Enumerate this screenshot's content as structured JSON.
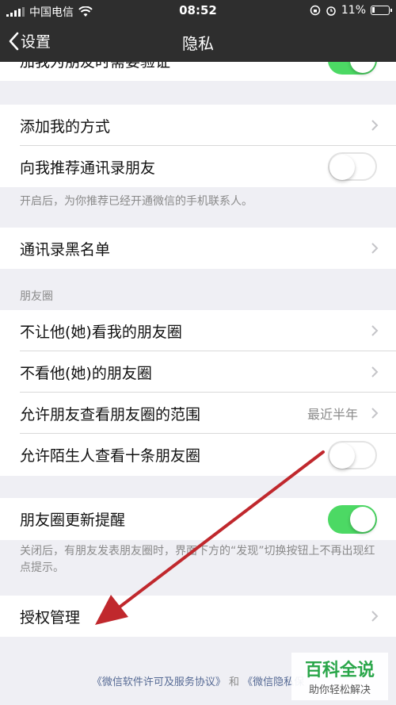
{
  "status_bar": {
    "carrier": "中国电信",
    "time": "08:52",
    "battery": "11%"
  },
  "nav": {
    "back_label": "设置",
    "title": "隐私"
  },
  "rows": {
    "verify": {
      "label": "加我为朋友时需要验证",
      "toggle": "on"
    },
    "add_methods": {
      "label": "添加我的方式"
    },
    "recommend": {
      "label": "向我推荐通讯录朋友",
      "toggle": "off"
    },
    "recommend_hint": "开启后，为你推荐已经开通微信的手机联系人。",
    "blacklist": {
      "label": "通讯录黑名单"
    },
    "moments_section": "朋友圈",
    "hide_from": {
      "label": "不让他(她)看我的朋友圈"
    },
    "not_see": {
      "label": "不看他(她)的朋友圈"
    },
    "range": {
      "label": "允许朋友查看朋友圈的范围",
      "value": "最近半年"
    },
    "strangers": {
      "label": "允许陌生人查看十条朋友圈",
      "toggle": "off"
    },
    "update_reminder": {
      "label": "朋友圈更新提醒",
      "toggle": "on"
    },
    "update_hint": "关闭后，有朋友发表朋友圈时，界面下方的“发现”切换按钮上不再出现红点提示。",
    "auth": {
      "label": "授权管理"
    }
  },
  "footer": {
    "link1": "《微信软件许可及服务协议》",
    "and": "和",
    "link2": "《微信隐私保"
  },
  "watermark": {
    "title": "百科全说",
    "subtitle": "助你轻松解决"
  },
  "colors": {
    "toggle_on": "#4cd964",
    "nav_bg": "#2e2e2e",
    "link": "#576b95",
    "arrow": "#c0282d"
  }
}
